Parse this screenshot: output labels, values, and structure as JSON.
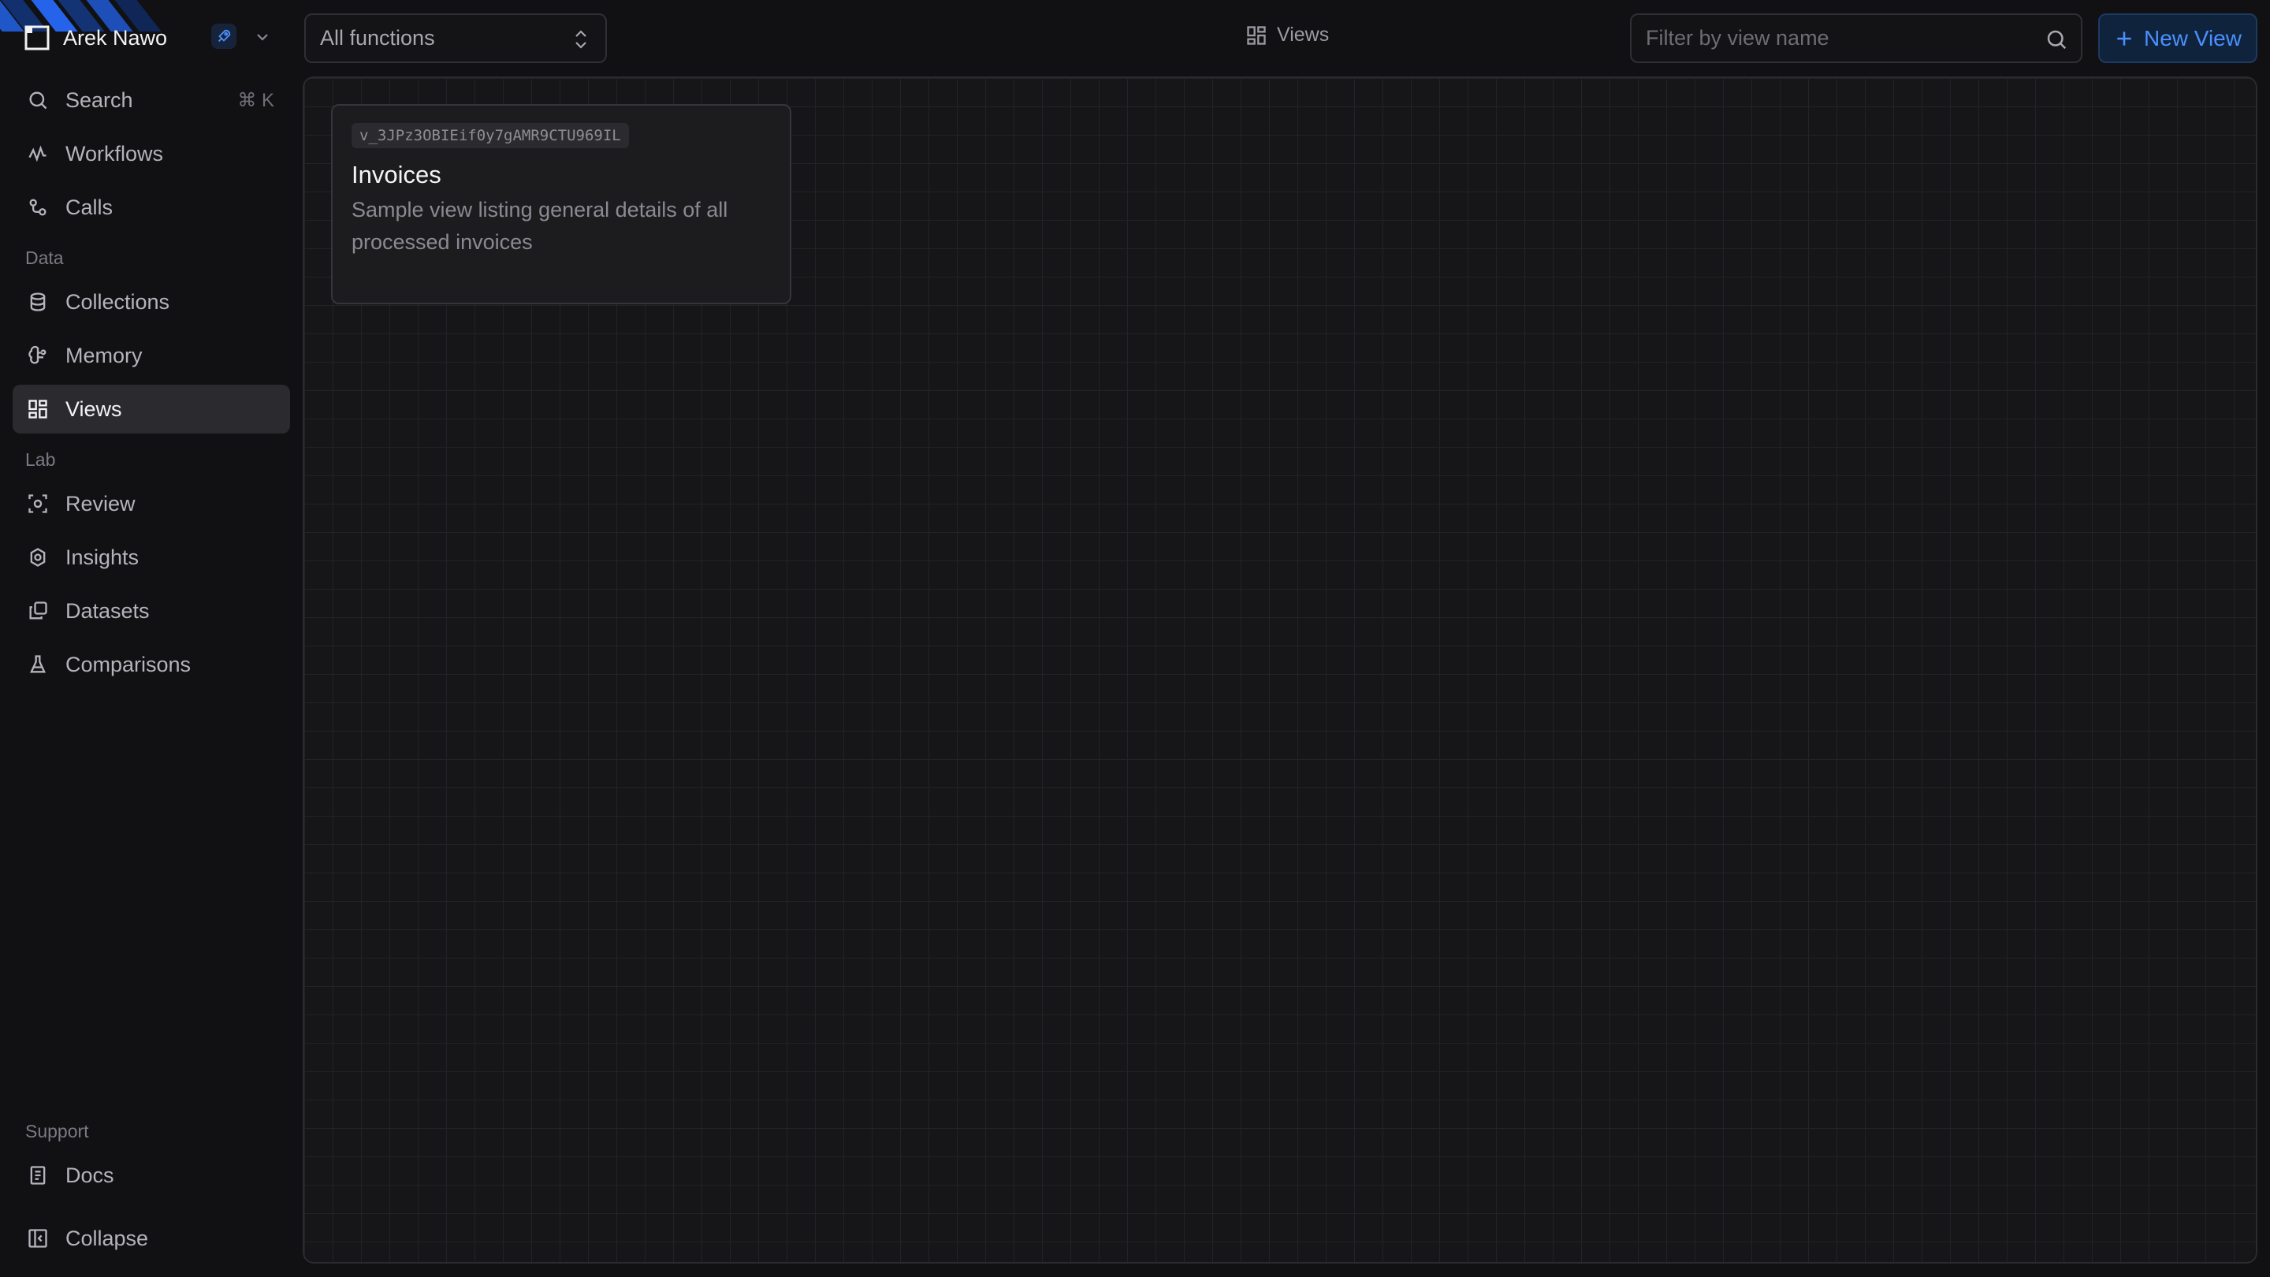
{
  "sidebar": {
    "user_name": "Arek Nawo",
    "nav_top": [
      {
        "label": "Search",
        "shortcut": "⌘ K"
      },
      {
        "label": "Workflows"
      },
      {
        "label": "Calls"
      }
    ],
    "section_data": "Data",
    "nav_data": [
      {
        "label": "Collections"
      },
      {
        "label": "Memory"
      },
      {
        "label": "Views"
      }
    ],
    "section_lab": "Lab",
    "nav_lab": [
      {
        "label": "Review"
      },
      {
        "label": "Insights"
      },
      {
        "label": "Datasets"
      },
      {
        "label": "Comparisons"
      }
    ],
    "section_support": "Support",
    "nav_support": [
      {
        "label": "Docs"
      },
      {
        "label": "Collapse"
      }
    ],
    "active_item": "Views"
  },
  "toolbar": {
    "function_select": "All functions",
    "page_title": "Views",
    "filter_placeholder": "Filter by view name",
    "new_view_label": "New View"
  },
  "views": [
    {
      "id": "v_3JPz3OBIEif0y7gAMR9CTU969IL",
      "title": "Invoices",
      "description": "Sample view listing general details of all processed invoices"
    }
  ],
  "colors": {
    "accent": "#4a90ff",
    "background": "#111113",
    "active_nav": "#2a2a2f"
  },
  "icons": {
    "brand": "square-logo-icon",
    "env": "rocket-icon",
    "search": "search-icon",
    "workflows": "workflow-icon",
    "calls": "calls-icon",
    "collections": "database-icon",
    "memory": "brain-icon",
    "views": "grid-icon",
    "review": "review-icon",
    "insights": "insights-icon",
    "datasets": "datasets-icon",
    "comparisons": "flask-icon",
    "docs": "docs-icon",
    "collapse": "collapse-icon"
  }
}
